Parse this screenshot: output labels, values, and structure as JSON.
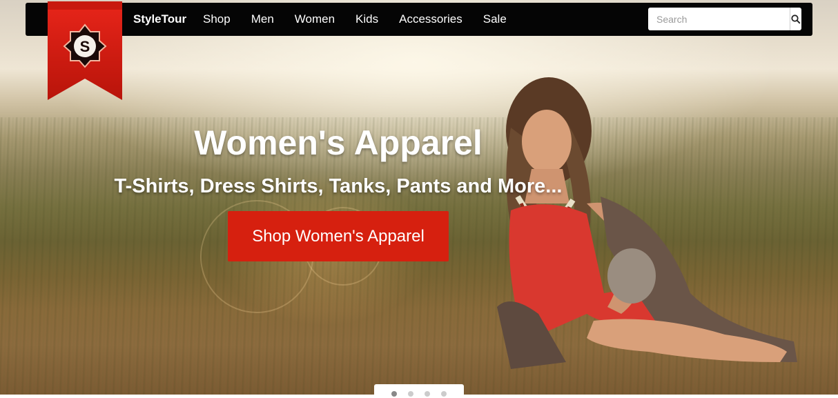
{
  "brand": {
    "name": "StyleTour",
    "logo_letter": "S"
  },
  "nav": {
    "items": [
      {
        "label": "Shop"
      },
      {
        "label": "Men"
      },
      {
        "label": "Women"
      },
      {
        "label": "Kids"
      },
      {
        "label": "Accessories"
      },
      {
        "label": "Sale"
      }
    ]
  },
  "search": {
    "placeholder": "Search",
    "value": "",
    "icon": "search-icon"
  },
  "hero": {
    "title": "Women's Apparel",
    "subtitle": "T-Shirts, Dress Shirts, Tanks, Pants and More...",
    "cta_label": "Shop Women's Apparel"
  },
  "carousel": {
    "slide_count": 4,
    "active_index": 0
  },
  "colors": {
    "navbar": "#050505",
    "cta": "#d6200f",
    "ribbon": "#d81e10",
    "text": "#ffffff"
  }
}
